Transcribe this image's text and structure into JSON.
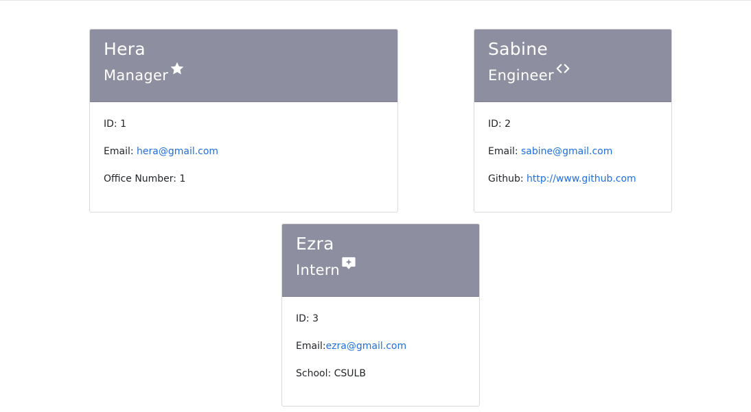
{
  "cards": [
    {
      "name": "Hera",
      "role": "Manager",
      "role_icon": "star-icon",
      "id_label": "ID: 1",
      "email_prefix": "Email: ",
      "email": "hera@gmail.com",
      "extra_label": "Office Number: 1"
    },
    {
      "name": "Sabine",
      "role": "Engineer",
      "role_icon": "code-icon",
      "id_label": "ID: 2",
      "email_prefix": "Email: ",
      "email": "sabine@gmail.com",
      "extra_prefix": "Github: ",
      "extra_link": "http://www.github.com"
    },
    {
      "name": "Ezra",
      "role": "Intern",
      "role_icon": "comment-sparkle-icon",
      "id_label": "ID: 3",
      "email_prefix": "Email:",
      "email": "ezra@gmail.com",
      "extra_label": "School: CSULB"
    }
  ],
  "colors": {
    "header_bg": "#8d8e9f",
    "link": "#1f6fe0",
    "border": "#d9d9d9"
  }
}
